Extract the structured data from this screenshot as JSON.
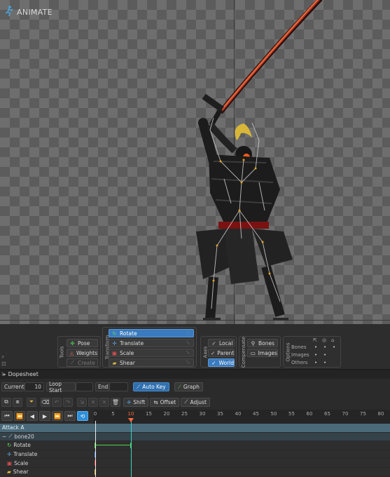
{
  "app": {
    "mode_label": "ANIMATE"
  },
  "toolbar": {
    "tools": {
      "title": "Tools",
      "pose": "Pose",
      "weights": "Weights",
      "create": "Create"
    },
    "transform": {
      "title": "Transform",
      "rotate": "Rotate",
      "translate": "Translate",
      "scale": "Scale",
      "shear": "Shear"
    },
    "axes": {
      "title": "Axes",
      "local": "Local",
      "parent": "Parent",
      "world": "World"
    },
    "compensate": {
      "title": "Compensate",
      "bones": "Bones",
      "images": "Images"
    },
    "options": {
      "title": "Options",
      "bones": "Bones",
      "images": "Images",
      "others": "Others"
    }
  },
  "dopesheet": {
    "title": "Dopesheet",
    "current_label": "Current",
    "current_value": "10",
    "loop_start_label": "Loop Start",
    "end_label": "End",
    "auto_key": "Auto Key",
    "graph": "Graph",
    "shift": "Shift",
    "offset": "Offset",
    "adjust": "Adjust",
    "ruler": [
      "0",
      "5",
      "10",
      "15",
      "20",
      "25",
      "30",
      "35",
      "40",
      "45",
      "50",
      "55",
      "60",
      "65",
      "70",
      "75",
      "80"
    ],
    "current_frame": "10",
    "tracks": {
      "animation": "Attack A",
      "bone": "bone20",
      "rotate": "Rotate",
      "translate": "Translate",
      "scale": "Scale",
      "shear": "Shear"
    }
  },
  "colors": {
    "accent": "#3a7bbf",
    "playhead": "#ff6a3d",
    "key_green": "#4fd14f"
  }
}
